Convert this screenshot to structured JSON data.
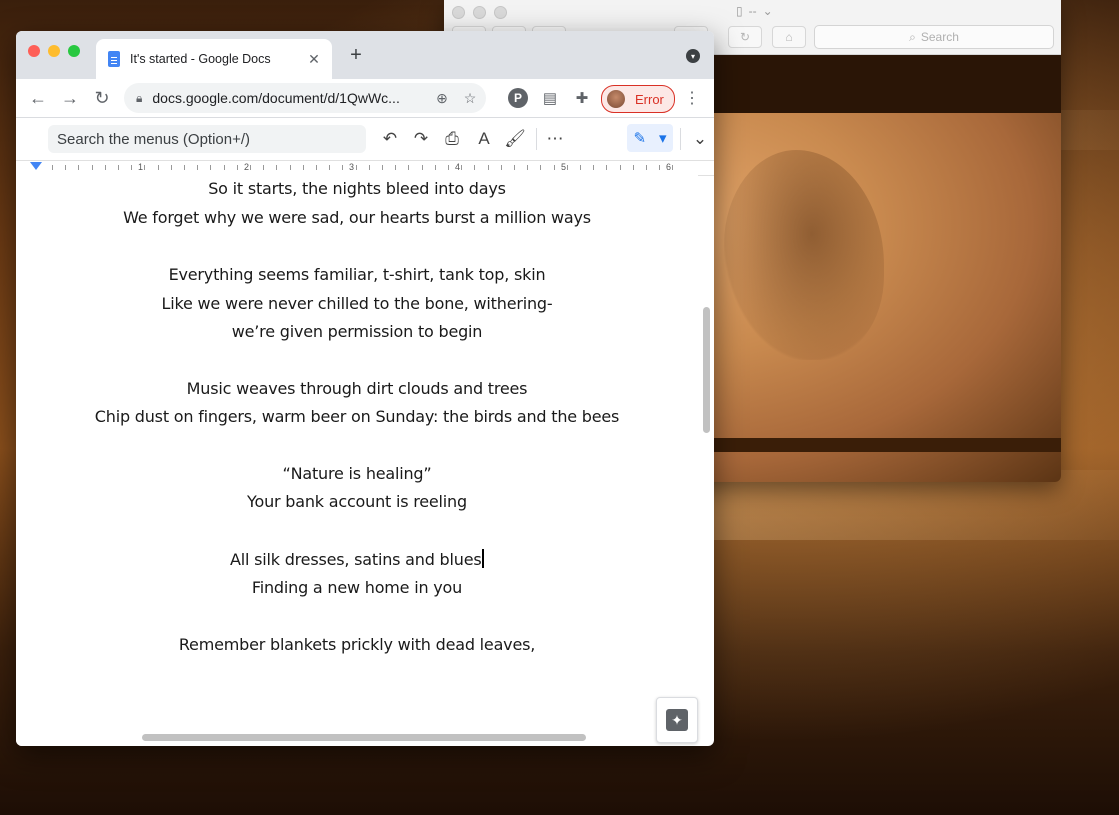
{
  "finder": {
    "title": "--",
    "search_placeholder": "Search"
  },
  "browser": {
    "tab_title": "It's started - Google Docs",
    "url": "docs.google.com/document/d/1QwWc...",
    "profile_status": "Error"
  },
  "docs": {
    "menu_search": "Search the menus (Option+/)",
    "ruler_numbers": [
      "1",
      "2",
      "3",
      "4",
      "5",
      "6"
    ],
    "lines": [
      "So it starts, the nights bleed into days",
      "We forget why we were sad, our hearts burst a million ways",
      "",
      "Everything seems familiar, t-shirt, tank top, skin",
      "Like we were never chilled to the bone, withering-",
      "we’re given permission to begin",
      "",
      "Music weaves through dirt clouds and trees",
      "Chip dust on fingers, warm beer on Sunday: the birds and the bees",
      "",
      "“Nature is healing”",
      "Your bank account is reeling",
      "",
      "All silk dresses, satins and blues",
      "Finding a new home in you",
      "",
      "Remember blankets prickly with dead leaves,"
    ]
  },
  "icons": {
    "back": "arrow-left-icon",
    "forward": "arrow-right-icon",
    "reload": "reload-icon",
    "lock": "lock-icon",
    "zoom": "zoom-icon",
    "star": "star-icon",
    "pinterest": "pinterest-icon",
    "extension": "puzzle-icon",
    "undo": "undo-icon",
    "redo": "redo-icon",
    "print": "print-icon",
    "spellcheck": "spellcheck-icon",
    "paint_format": "paint-format-icon",
    "more": "more-icon",
    "edit_mode": "pencil-icon",
    "explore": "explore-icon"
  }
}
